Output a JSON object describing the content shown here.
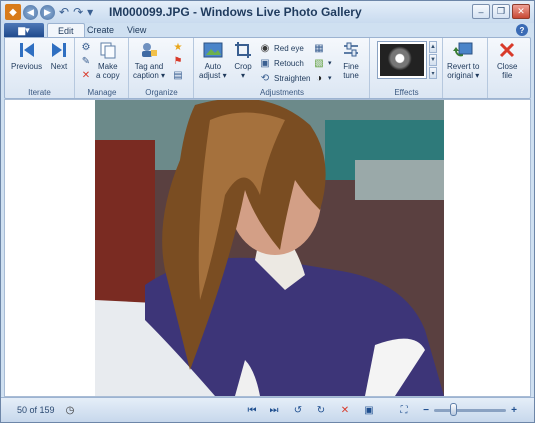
{
  "window": {
    "title": "IM000099.JPG - Windows Live Photo Gallery",
    "controls": {
      "minimize": "–",
      "maximize": "❐",
      "close": "✕"
    }
  },
  "quick_access": {
    "app_icon": "photo-gallery-icon",
    "back": "◀",
    "forward": "▶",
    "undo": "↶",
    "redo": "↷",
    "dropdown": "▾"
  },
  "tabs": [
    {
      "label": "Edit",
      "active": true
    },
    {
      "label": "Create",
      "active": false
    },
    {
      "label": "View",
      "active": false
    }
  ],
  "app_menu_glyph": "▆▾",
  "help_glyph": "?",
  "ribbon": {
    "iterate": {
      "label": "Iterate",
      "previous": "Previous",
      "next": "Next"
    },
    "manage": {
      "label": "Manage",
      "make_copy_line1": "Make",
      "make_copy_line2": "a copy"
    },
    "organize": {
      "label": "Organize",
      "tag_caption_line1": "Tag and",
      "tag_caption_line2": "caption ▾"
    },
    "adjustments": {
      "label": "Adjustments",
      "auto_adjust_line1": "Auto",
      "auto_adjust_line2": "adjust ▾",
      "crop_line1": "Crop",
      "crop_line2": "▾",
      "red_eye": "Red eye",
      "retouch": "Retouch",
      "straighten": "Straighten",
      "fine_tune_line1": "Fine",
      "fine_tune_line2": "tune"
    },
    "effects": {
      "label": "Effects"
    },
    "revert": {
      "line1": "Revert to",
      "line2": "original ▾"
    },
    "close_file": {
      "line1": "Close",
      "line2": "file"
    }
  },
  "statusbar": {
    "count": "50 of 159",
    "zoom": {
      "min": "−",
      "max": "+",
      "level": 0.25
    }
  },
  "colors": {
    "accent": "#1f4a8c",
    "ribbon_text": "#1e395b",
    "close_red": "#d83a2a"
  }
}
